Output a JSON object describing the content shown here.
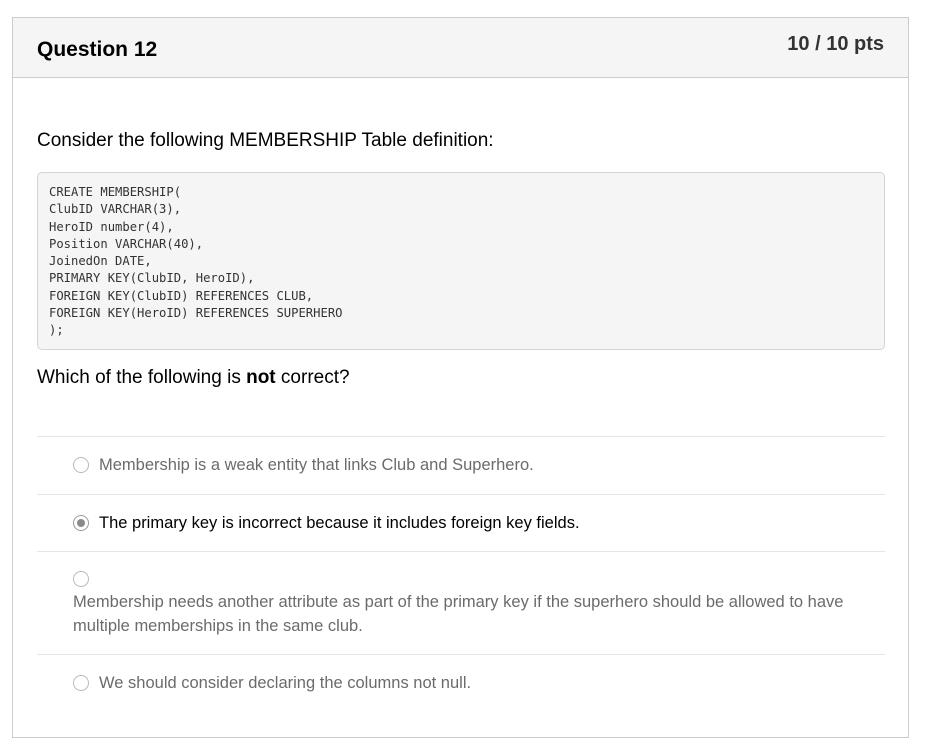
{
  "question": {
    "title": "Question 12",
    "points": "10 / 10 pts"
  },
  "intro": "Consider the following MEMBERSHIP Table definition:",
  "code": "CREATE MEMBERSHIP(\nClubID VARCHAR(3),\nHeroID number(4),\nPosition VARCHAR(40),\nJoinedOn DATE,\nPRIMARY KEY(ClubID, HeroID),\nFOREIGN KEY(ClubID) REFERENCES CLUB,\nFOREIGN KEY(HeroID) REFERENCES SUPERHERO\n);",
  "prompt": {
    "before": "Which of the following is ",
    "emphasis": "not",
    "after": " correct?"
  },
  "answers": [
    {
      "text": "Membership is a weak entity that links Club and Superhero.",
      "selected": false
    },
    {
      "text": "The primary key is incorrect because it includes foreign key fields.",
      "selected": true
    },
    {
      "text": "Membership needs another attribute as part of the primary key if the superhero should be allowed  to have multiple memberships in the same club.",
      "selected": false
    },
    {
      "text": "We should consider declaring the columns not null.",
      "selected": false
    }
  ]
}
